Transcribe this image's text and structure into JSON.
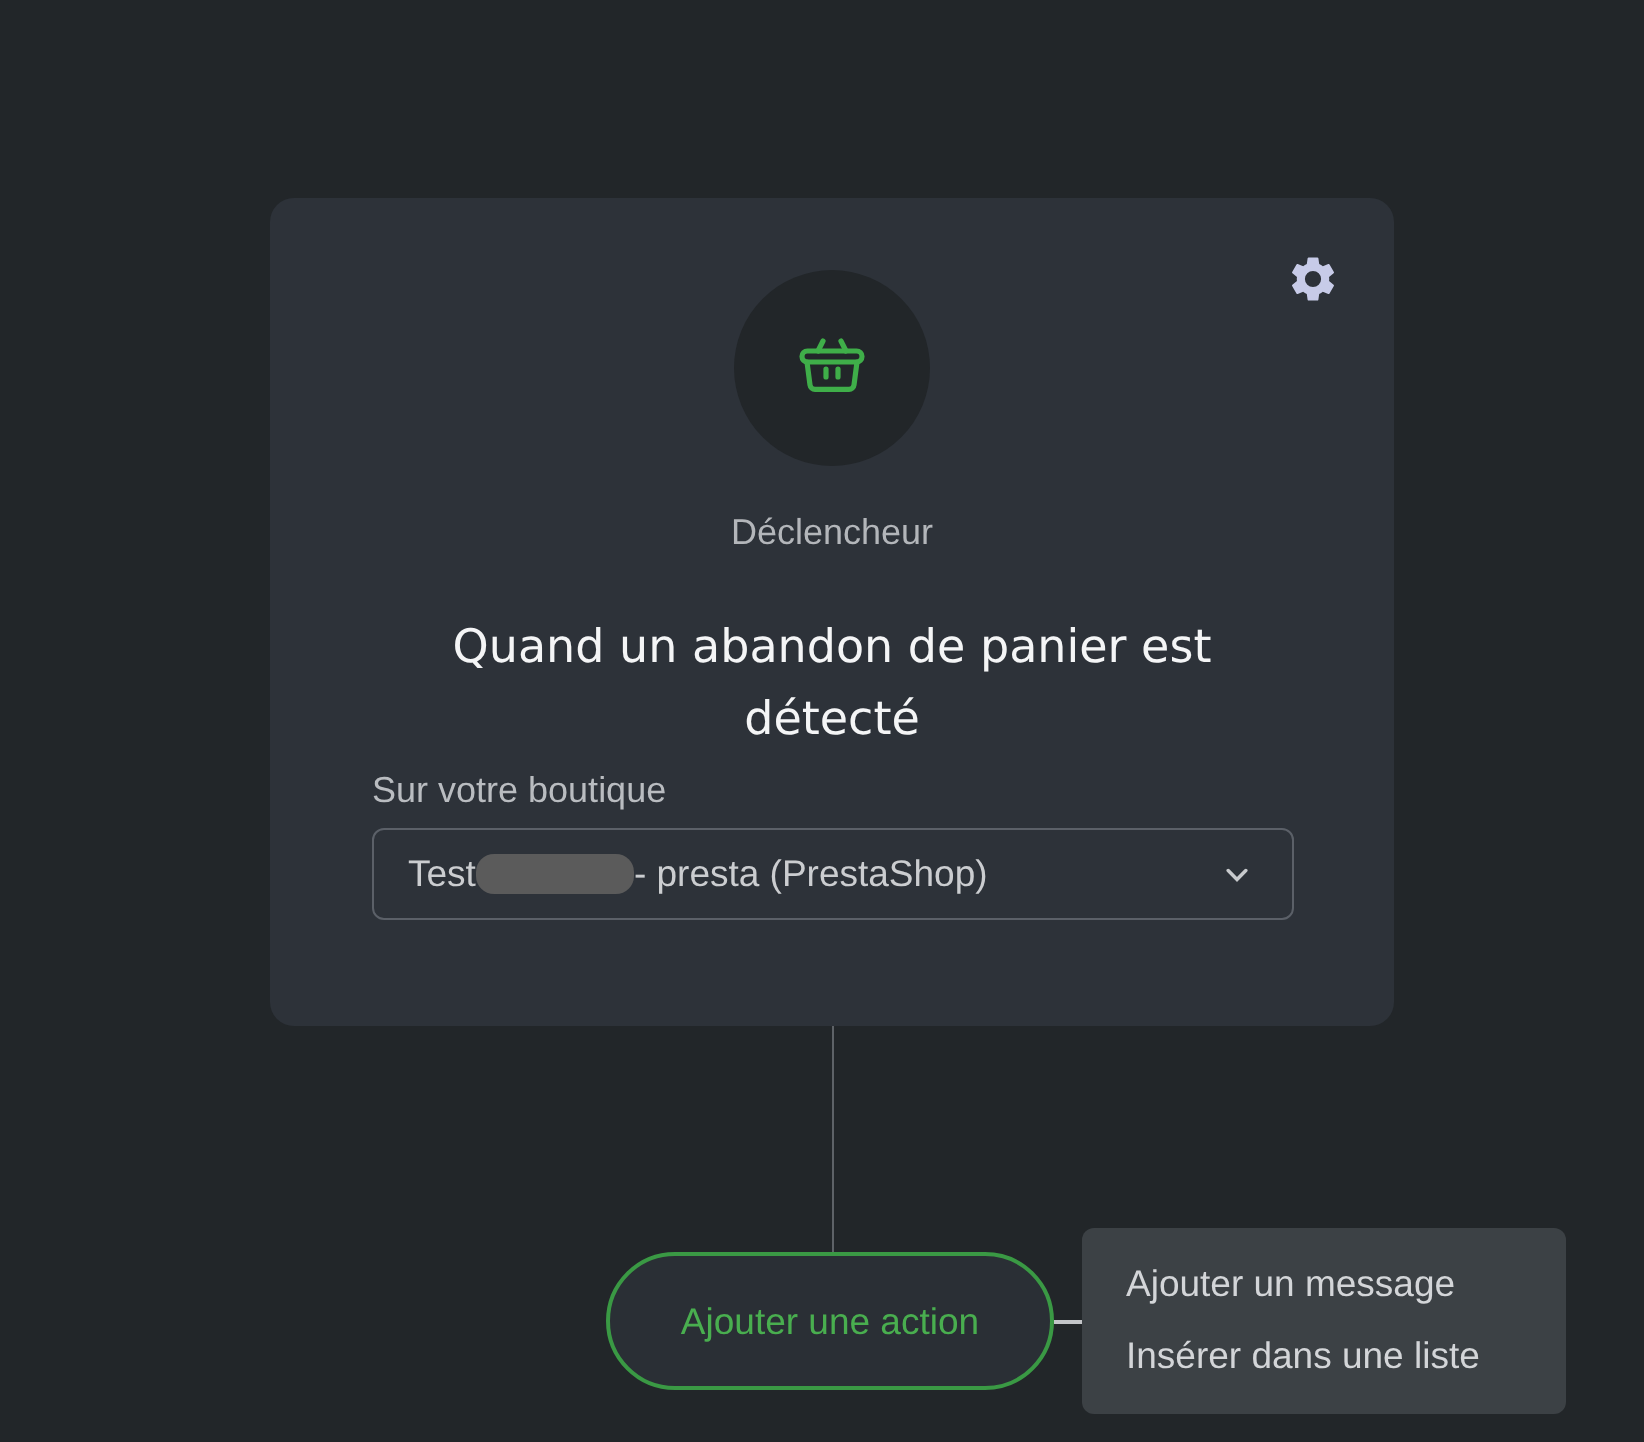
{
  "trigger": {
    "label": "Déclencheur",
    "title": "Quand un abandon de panier est détecté",
    "field": {
      "label": "Sur votre boutique",
      "value": [
        {
          "kind": "text",
          "text": "Test"
        },
        {
          "kind": "redacted"
        },
        {
          "kind": "text",
          "text": "- presta (PrestaShop)"
        }
      ]
    }
  },
  "add_action": {
    "label": "Ajouter une action"
  },
  "action_menu": {
    "items": [
      {
        "label": "Ajouter un message"
      },
      {
        "label": "Insérer dans une liste"
      }
    ]
  }
}
